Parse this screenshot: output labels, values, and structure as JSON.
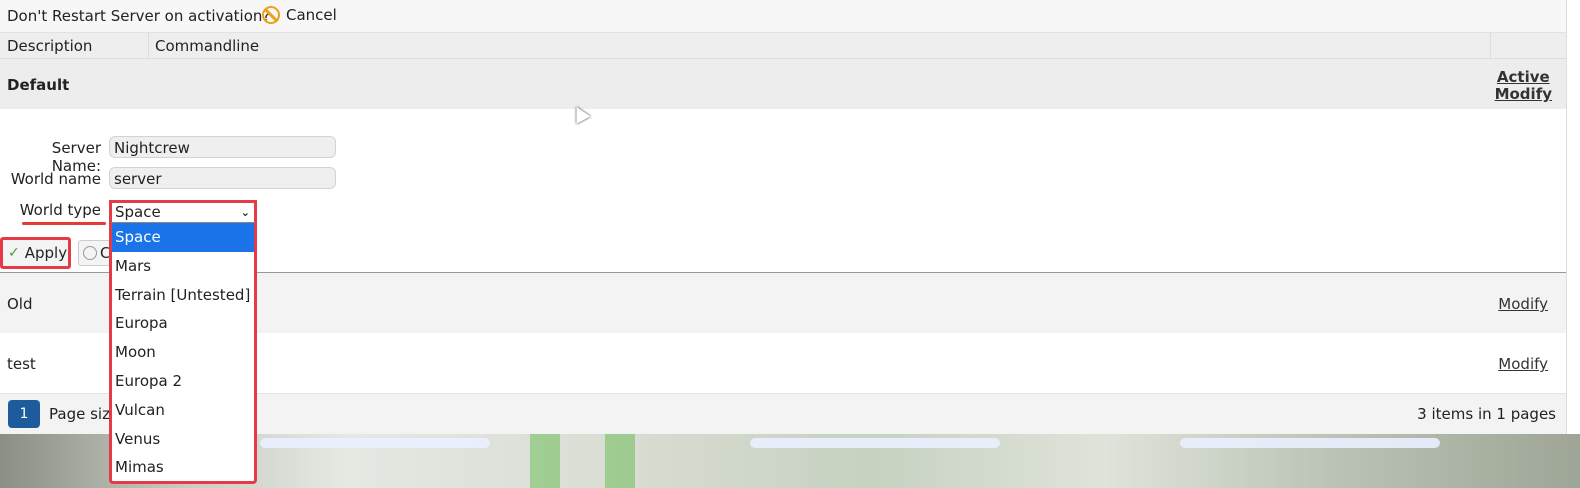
{
  "top_bar": {
    "question": "Don't Restart Server on activation?",
    "cancel_label": "Cancel"
  },
  "columns": {
    "description": "Description",
    "commandline": "Commandline"
  },
  "default_row": {
    "name": "Default",
    "active_label": "Active",
    "modify_label": "Modify"
  },
  "form": {
    "server_name_label": "Server Name:",
    "server_name_value": "Nightcrew",
    "world_name_label": "World name",
    "world_name_value": "server",
    "world_type_label": "World type",
    "world_type_selected": "Space",
    "world_type_options": [
      "Space",
      "Mars",
      "Terrain [Untested]",
      "Europa",
      "Moon",
      "Europa 2",
      "Vulcan",
      "Venus",
      "Mimas"
    ],
    "apply_label": "Apply",
    "cancel_partial": "C"
  },
  "rows": [
    {
      "name": "Old",
      "modify_label": "Modify"
    },
    {
      "name": "test",
      "modify_label": "Modify"
    }
  ],
  "pager": {
    "page": "1",
    "page_size_label": "Page size",
    "info": "3 items in 1 pages"
  },
  "colors": {
    "highlight_red": "#e53b46",
    "selected_blue": "#1a73e8",
    "pager_blue": "#1e5b9c"
  }
}
